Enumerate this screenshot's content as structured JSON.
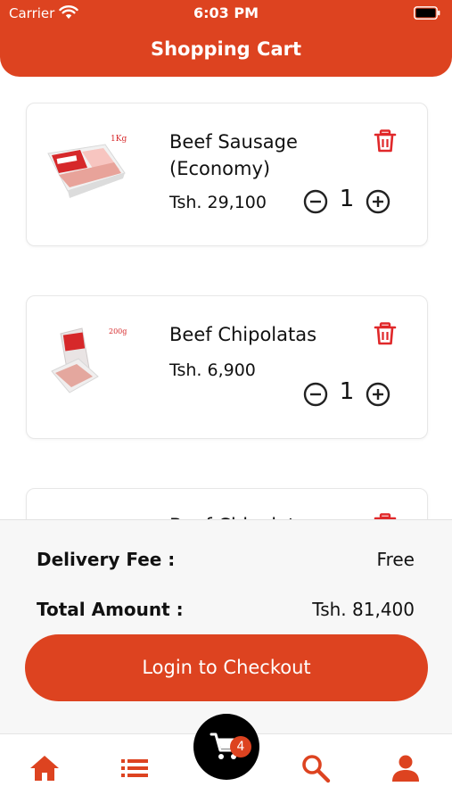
{
  "status_bar": {
    "carrier": "Carrier",
    "time": "6:03 PM"
  },
  "header": {
    "title": "Shopping Cart"
  },
  "cart": {
    "items": [
      {
        "name": "Beef Sausage (Economy)",
        "price": "Tsh. 29,100",
        "quantity": "1",
        "thumb_label": "1Kg"
      },
      {
        "name": "Beef Chipolatas",
        "price": "Tsh. 6,900",
        "quantity": "1",
        "thumb_label": "200g"
      },
      {
        "name": "Beef Chipolatas"
      }
    ]
  },
  "summary": {
    "delivery_label": "Delivery Fee :",
    "delivery_value": "Free",
    "total_label": "Total Amount :",
    "total_value": "Tsh. 81,400",
    "checkout_label": "Login to Checkout"
  },
  "nav": {
    "cart_badge": "4"
  },
  "colors": {
    "accent": "#dd4320",
    "fab": "#000000",
    "trash": "#e0282a"
  },
  "icons": [
    "wifi-icon",
    "battery-icon",
    "trash-icon",
    "minus-circle-icon",
    "plus-circle-icon",
    "home-icon",
    "list-icon",
    "cart-icon",
    "search-icon",
    "user-icon"
  ]
}
